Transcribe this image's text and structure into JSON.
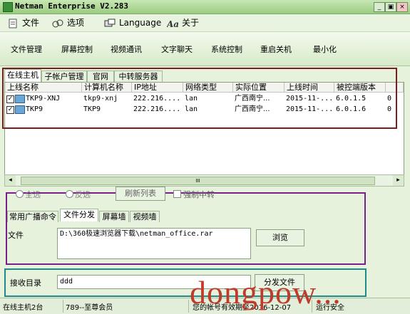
{
  "window": {
    "title": "Netman Enterprise V2.283",
    "min": "_",
    "restore": "▣",
    "close": "×"
  },
  "menu": [
    {
      "label": "文件",
      "icon": "file-menu-icon"
    },
    {
      "label": "选项",
      "icon": "options-menu-icon"
    },
    {
      "label": "Language",
      "icon": "language-menu-icon"
    },
    {
      "label": "关于",
      "icon": "about-menu-icon"
    }
  ],
  "toolbar": [
    "文件管理",
    "屏幕控制",
    "视频通讯",
    "文字聊天",
    "系统控制",
    "重启关机",
    "最小化"
  ],
  "hostTabs": [
    "在线主机",
    "子帐户管理",
    "官网",
    "中转服务器"
  ],
  "columns": [
    "上线名称",
    "计算机名称",
    "IP地址",
    "网络类型",
    "实际位置",
    "上线时间",
    "被控端版本"
  ],
  "rows": [
    {
      "checked": true,
      "cells": [
        "TKP9-XNJ",
        "tkp9-xnj",
        "222.216....",
        "lan",
        "广西南宁...",
        "2015-11-...",
        "6.0.1.5",
        "0"
      ]
    },
    {
      "checked": true,
      "cells": [
        "TKP9",
        "TKP9",
        "222.216....",
        "lan",
        "广西南宁...",
        "2015-11-...",
        "6.0.1.6",
        "0"
      ]
    }
  ],
  "scrollbar": {
    "grip": "III",
    "left": "◂",
    "right": "▸"
  },
  "selection": {
    "select_all": "全选",
    "invert": "反选",
    "refresh": "刷新列表",
    "force_relay": "强制中转"
  },
  "cmdTabs": [
    "常用广播命令",
    "文件分发",
    "屏幕墙",
    "视频墙"
  ],
  "file": {
    "label": "文件",
    "value": "D:\\360极速浏览器下载\\netman_office.rar",
    "browse": "浏览"
  },
  "receive": {
    "label": "接收目录",
    "value": "ddd",
    "distribute": "分发文件"
  },
  "status": {
    "online": "在线主机2台",
    "member": "789--至尊会员",
    "expiry": "您的帐号有效期至2016-12-07",
    "safety": "运行安全"
  },
  "watermark": "dongpow...",
  "colors": {
    "bracket_dark_red": "#7a1f1f",
    "bracket_purple": "#7a1f8a",
    "bracket_teal": "#1f8a8a"
  }
}
